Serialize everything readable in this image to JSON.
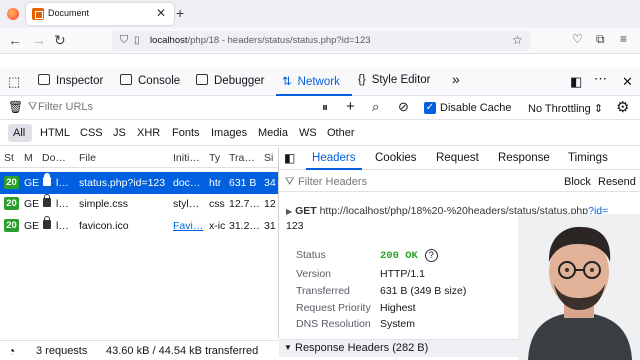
{
  "browser": {
    "tab_title": "Document",
    "url_host": "localhost",
    "url_path": "/php/18 - headers/status/status.php?id=123"
  },
  "devtools": {
    "tabs": [
      "Inspector",
      "Console",
      "Debugger",
      "Network",
      "Style Editor"
    ],
    "filter_placeholder": "Filter URLs",
    "disable_cache": "Disable Cache",
    "throttling": "No Throttling ⇕",
    "types": [
      "All",
      "HTML",
      "CSS",
      "JS",
      "XHR",
      "Fonts",
      "Images",
      "Media",
      "WS",
      "Other"
    ],
    "columns": [
      "St",
      "M",
      "Do…",
      "File",
      "Initi…",
      "Ty",
      "Tra…",
      "Si"
    ],
    "requests": [
      {
        "status": "20",
        "method": "GE",
        "domain": "l…",
        "file": "status.php?id=123",
        "initiator": "doc…",
        "type": "htr",
        "transferred": "631 B",
        "size": "34"
      },
      {
        "status": "20",
        "method": "GE",
        "domain": "l…",
        "file": "simple.css",
        "initiator": "styl…",
        "type": "css",
        "transferred": "12.7…",
        "size": "12"
      },
      {
        "status": "20",
        "method": "GE",
        "domain": "l…",
        "file": "favicon.ico",
        "initiator": "Favi…",
        "type": "x-ic",
        "transferred": "31.2…",
        "size": "31"
      }
    ],
    "status_summary": {
      "requests": "3 requests",
      "sizes": "43.60 kB / 44.54 kB transferred"
    },
    "details": {
      "tabs": [
        "Headers",
        "Cookies",
        "Request",
        "Response",
        "Timings"
      ],
      "filter_placeholder": "Filter Headers",
      "block": "Block",
      "resend": "Resend",
      "method": "GET",
      "url_plain": "http://localhost/php/18%20-%20headers/status/status.php",
      "url_query": "?id=",
      "url_query_value": "123",
      "rows": [
        {
          "label": "Status",
          "value": "200 OK"
        },
        {
          "label": "Version",
          "value": "HTTP/1.1"
        },
        {
          "label": "Transferred",
          "value": "631 B (349 B size)"
        },
        {
          "label": "Request Priority",
          "value": "Highest"
        },
        {
          "label": "DNS Resolution",
          "value": "System"
        }
      ],
      "response_headers": "Response Headers (282 B)"
    }
  },
  "colors": {
    "accent": "#0060df",
    "status_ok": "#2aa02a"
  }
}
